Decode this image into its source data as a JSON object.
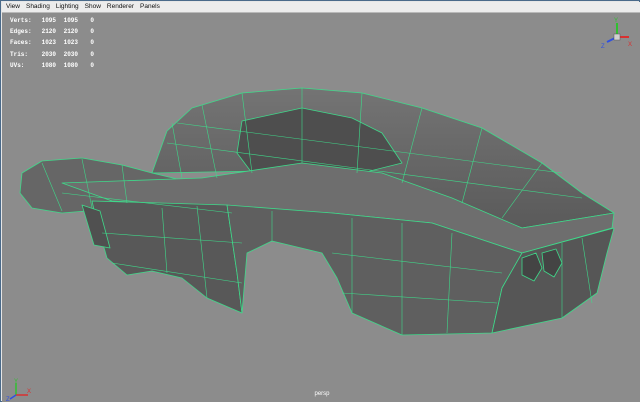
{
  "menu": [
    "View",
    "Shading",
    "Lighting",
    "Show",
    "Renderer",
    "Panels"
  ],
  "stats": [
    {
      "label": "Verts:",
      "values": [
        "1095",
        "1095",
        "0"
      ]
    },
    {
      "label": "Edges:",
      "values": [
        "2120",
        "2120",
        "0"
      ]
    },
    {
      "label": "Faces:",
      "values": [
        "1023",
        "1023",
        "0"
      ]
    },
    {
      "label": "Tris:",
      "values": [
        "2030",
        "2030",
        "0"
      ]
    },
    {
      "label": "UVs:",
      "values": [
        "1080",
        "1080",
        "0"
      ]
    }
  ],
  "camera_label": "persp",
  "view_cube_axes": {
    "y": "Y",
    "x": "X",
    "z": "Z"
  },
  "origin_axes": {
    "y": "Y",
    "x": "X",
    "z": "Z"
  },
  "colors": {
    "viewport_bg": "#8c8c8c",
    "mesh_face": "#5c5c5c",
    "wireframe": "#3fd98a",
    "axis_x": "#d93030",
    "axis_y": "#30c030",
    "axis_z": "#3050e0"
  }
}
